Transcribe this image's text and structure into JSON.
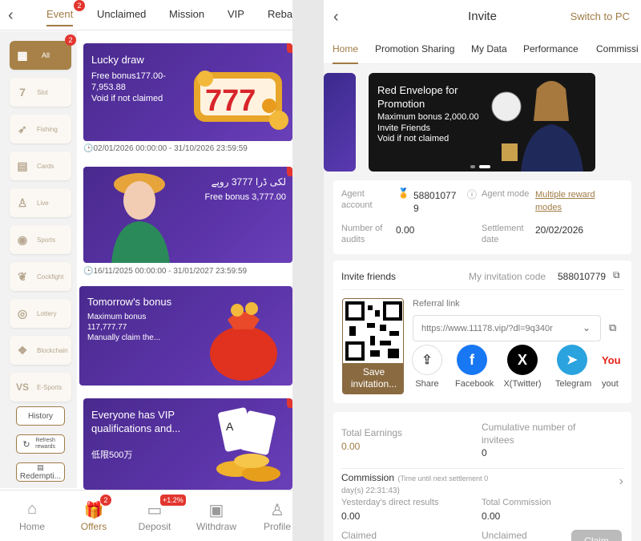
{
  "left": {
    "tabs": [
      {
        "label": "Event",
        "badge": "2",
        "active": true
      },
      {
        "label": "Unclaimed"
      },
      {
        "label": "Mission"
      },
      {
        "label": "VIP"
      },
      {
        "label": "Rebat"
      }
    ],
    "sidebar": {
      "all_badge": "2",
      "items": [
        {
          "label": "All",
          "icon": "grid-icon"
        },
        {
          "label": "Slot",
          "icon": "slot-777-icon"
        },
        {
          "label": "Fishing",
          "icon": "fish-icon"
        },
        {
          "label": "Cards",
          "icon": "cards-icon"
        },
        {
          "label": "Live",
          "icon": "live-dealer-icon"
        },
        {
          "label": "Sports",
          "icon": "soccer-ball-icon"
        },
        {
          "label": "Cockfight",
          "icon": "rooster-icon"
        },
        {
          "label": "Lottery",
          "icon": "lottery-icon"
        },
        {
          "label": "Blockchain",
          "icon": "blockchain-icon"
        },
        {
          "label": "E-Sports",
          "icon": "vs-icon"
        }
      ],
      "history": "History",
      "refresh": "Refresh rewards",
      "redemption": "Redempti..."
    },
    "promos": [
      {
        "title": "Lucky draw",
        "line1": "Free bonus177.00-",
        "line2": "7,953.88",
        "line3": "Void if not claimed",
        "date": "02/01/2026 00:00:00 - 31/10/2026 23:59:59"
      },
      {
        "title": "لکی ڈرا 3777 روپے",
        "line1": "Free bonus 3,777.00",
        "date": "16/11/2025 00:00:00 - 31/01/2027 23:59:59"
      },
      {
        "title": "Tomorrow's bonus",
        "line1": "Maximum bonus",
        "line2": "117,777.77",
        "line3": "Manually claim the..."
      },
      {
        "title": "Everyone has VIP",
        "title2": "qualifications and...",
        "line1": "低限500万"
      }
    ],
    "nav": [
      {
        "label": "Home",
        "icon": "home-icon"
      },
      {
        "label": "Offers",
        "icon": "gift-icon",
        "badge": "2",
        "active": true
      },
      {
        "label": "Deposit",
        "icon": "wallet-icon",
        "badge": "+1.2%"
      },
      {
        "label": "Withdraw",
        "icon": "cash-icon"
      },
      {
        "label": "Profile",
        "icon": "person-icon"
      }
    ]
  },
  "right": {
    "title": "Invite",
    "switch_label": "Switch to PC",
    "tabs": [
      "Home",
      "Promotion Sharing",
      "My Data",
      "Performance",
      "Commissi"
    ],
    "banner": {
      "title1": "Red Envelope for",
      "title2": "Promotion",
      "line1": "Maximum bonus 2,000.00",
      "line2": "Invite Friends",
      "line3": "Void if not claimed"
    },
    "agent": {
      "account_label1": "Agent",
      "account_label2": "account",
      "account_value1": "58801077",
      "account_value2": "9",
      "mode_label": "Agent mode",
      "mode_value1": "Multiple reward",
      "mode_value2": "modes",
      "audits_label1": "Number of",
      "audits_label2": "audits",
      "audits_value": "0.00",
      "settlement_label1": "Settlement",
      "settlement_label2": "date",
      "settlement_value": "20/02/2026"
    },
    "invite": {
      "title": "Invite friends",
      "code_label": "My invitation code",
      "code_value": "588010779",
      "referral_label": "Referral link",
      "referral_value": "https://www.11178.vip/?dl=9q340r",
      "save_label1": "Save",
      "save_label2": "invitation...",
      "share": [
        {
          "label": "Share",
          "icon": "share-icon"
        },
        {
          "label": "Facebook",
          "icon": "facebook-icon"
        },
        {
          "label": "X(Twitter)",
          "icon": "x-twitter-icon"
        },
        {
          "label": "Telegram",
          "icon": "telegram-icon"
        },
        {
          "label": "yout",
          "icon": "youtube-icon"
        }
      ]
    },
    "stats": {
      "total_earnings_label": "Total Earnings",
      "total_earnings_value": "0.00",
      "invitees_label1": "Cumulative number of",
      "invitees_label2": "invitees",
      "invitees_value": "0",
      "commission_label": "Commission",
      "commission_note1": "(Time until next settlement  0",
      "commission_note2": "day(s) 22:31:43)",
      "yesterday_label": "Yesterday's direct results",
      "yesterday_value": "0.00",
      "total_commission_label": "Total Commission",
      "total_commission_value": "0.00",
      "claimed_label": "Claimed",
      "unclaimed_label": "Unclaimed",
      "claim_button": "Claim"
    }
  },
  "colors": {
    "accent": "#a07b45",
    "badge": "#e2362f",
    "promo_purple": "#4a2a8e"
  }
}
